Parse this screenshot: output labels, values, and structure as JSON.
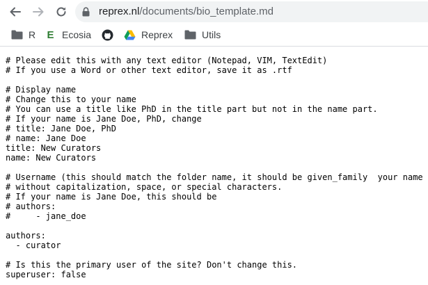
{
  "browser": {
    "url_host": "reprex.nl",
    "url_path": "/documents/bio_template.md",
    "icons": {
      "back": "arrow-left-icon",
      "forward": "arrow-right-icon",
      "reload": "reload-icon",
      "lock": "lock-icon"
    }
  },
  "bookmarks": [
    {
      "label": "R",
      "icon": "folder-icon"
    },
    {
      "label": "Ecosia",
      "icon": "ecosia-icon"
    },
    {
      "label": "",
      "icon": "github-icon"
    },
    {
      "label": "Reprex",
      "icon": "google-drive-icon"
    },
    {
      "label": "Utils",
      "icon": "folder-icon"
    }
  ],
  "document": {
    "lines": [
      "# Please edit this with any text editor (Notepad, VIM, TextEdit)",
      "# If you use a Word or other text editor, save it as .rtf",
      "",
      "# Display name",
      "# Change this to your name",
      "# You can use a title like PhD in the title part but not in the name part.",
      "# If your name is Jane Doe, PhD, change",
      "# title: Jane Doe, PhD",
      "# name: Jane Doe",
      "title: New Curators",
      "name: New Curators",
      "",
      "# Username (this should match the folder name, it should be given_family  your name",
      "# without capitalization, space, or special characters.",
      "# If your name is Jane Doe, this should be",
      "# authors:",
      "#     - jane_doe",
      "",
      "authors:",
      "  - curator",
      "",
      "# Is this the primary user of the site? Don't change this.",
      "superuser: false"
    ]
  }
}
